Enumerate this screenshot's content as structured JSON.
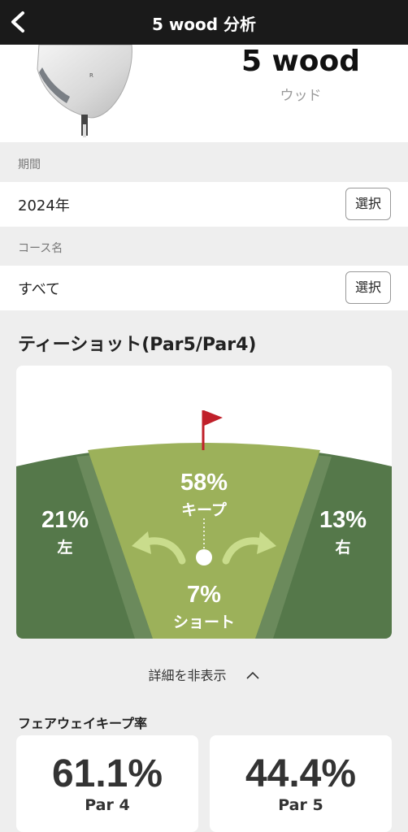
{
  "header": {
    "title": "5 wood 分析"
  },
  "club": {
    "name": "5 wood",
    "type": "ウッド"
  },
  "period": {
    "label": "期間",
    "value": "2024年",
    "button": "選択"
  },
  "course": {
    "label": "コース名",
    "value": "すべて",
    "button": "選択"
  },
  "tee_shot": {
    "title": "ティーショット(Par5/Par4)",
    "keep": {
      "pct": "58%",
      "label": "キープ"
    },
    "left": {
      "pct": "21%",
      "label": "左"
    },
    "right": {
      "pct": "13%",
      "label": "右"
    },
    "short": {
      "pct": "7%",
      "label": "ショート"
    },
    "colors": {
      "fairway": "#9cb15a",
      "rough": "#55784a",
      "rough_edge": "#6b8a5c",
      "flag": "#c0202a"
    }
  },
  "details_toggle": "詳細を非表示",
  "fairway_keep": {
    "label": "フェアウェイキープ率",
    "cards": [
      {
        "value": "61.1%",
        "sub": "Par 4"
      },
      {
        "value": "44.4%",
        "sub": "Par 5"
      }
    ]
  }
}
